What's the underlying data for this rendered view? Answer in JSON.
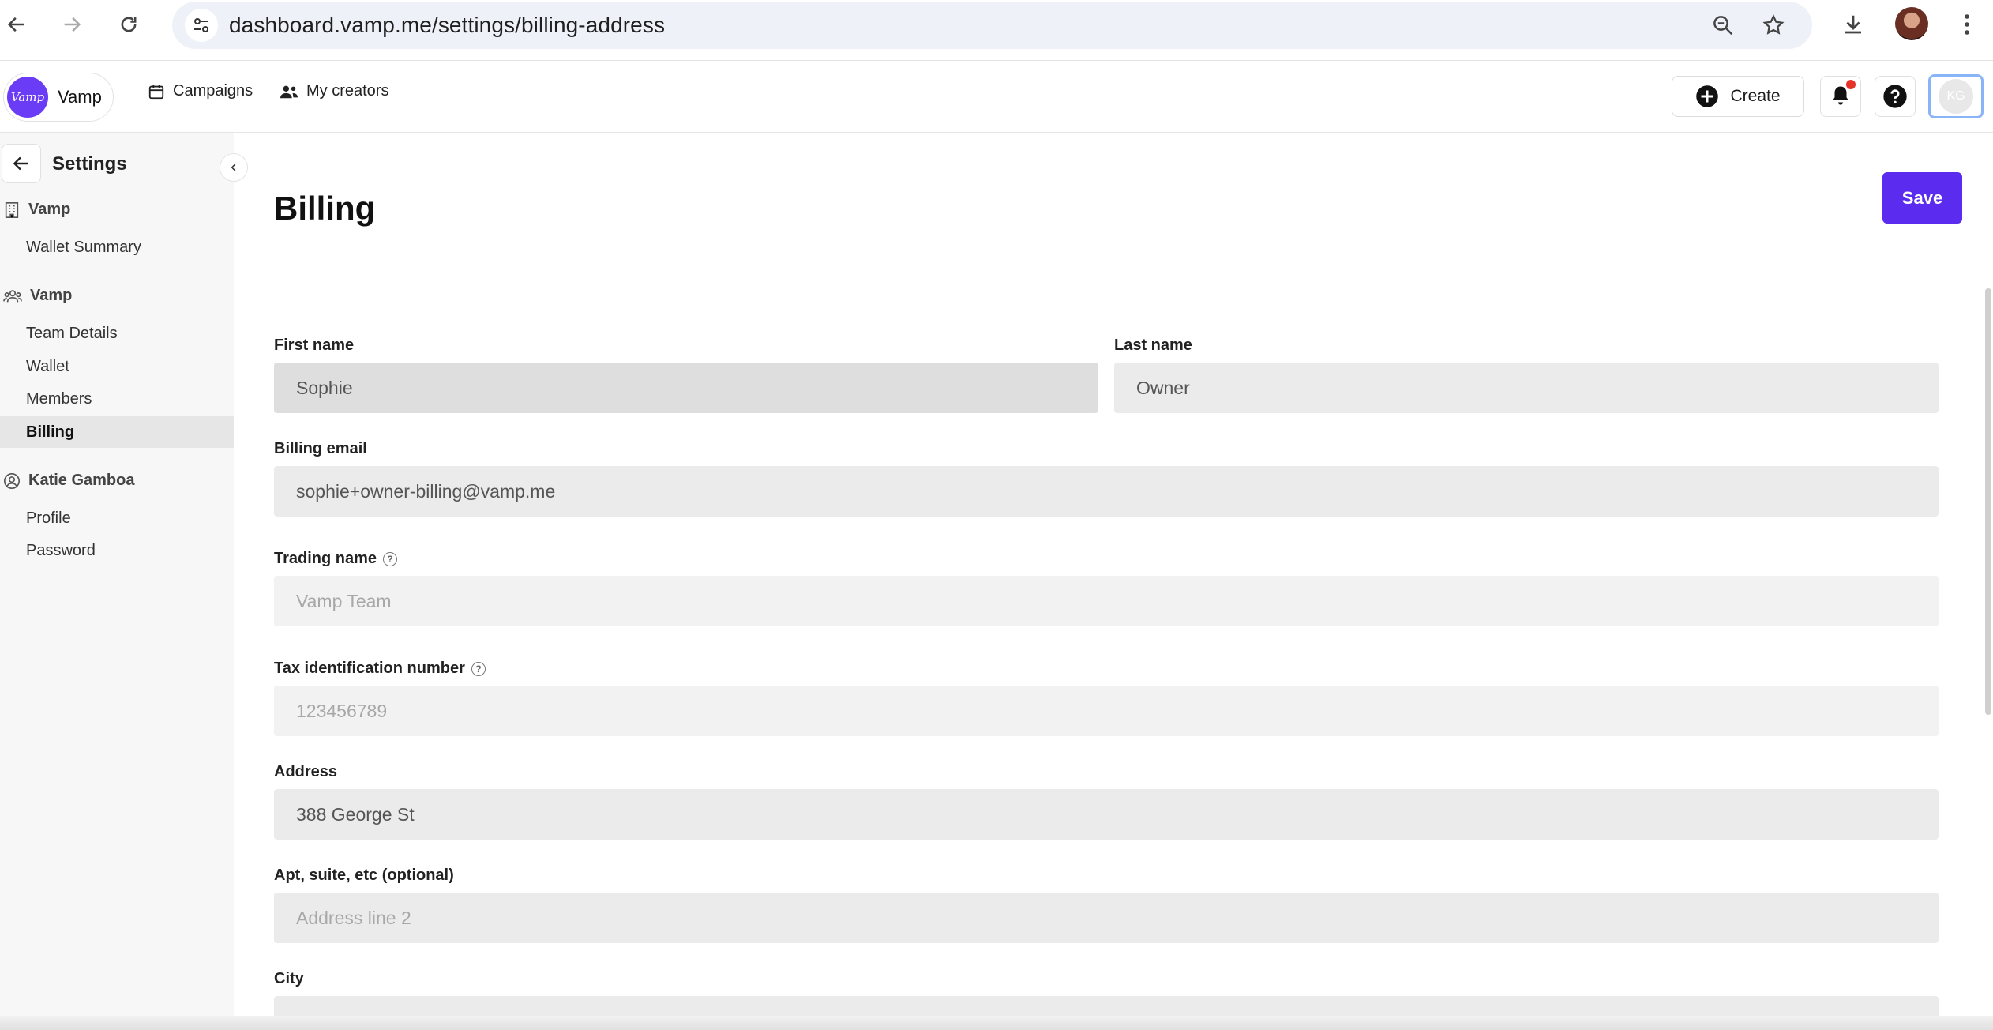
{
  "browser": {
    "url": "dashboard.vamp.me/settings/billing-address"
  },
  "header": {
    "brand_logo_text": "Vamp",
    "brand_name": "Vamp",
    "nav": [
      {
        "label": "Campaigns",
        "icon": "calendar-icon"
      },
      {
        "label": "My creators",
        "icon": "users-icon"
      }
    ],
    "create_label": "Create",
    "avatar_initials": "KG"
  },
  "sidebar": {
    "title": "Settings",
    "groups": [
      {
        "label": "Vamp",
        "icon": "building-icon",
        "items": [
          "Wallet Summary"
        ]
      },
      {
        "label": "Vamp",
        "icon": "team-icon",
        "items": [
          "Team Details",
          "Wallet",
          "Members",
          "Billing"
        ]
      },
      {
        "label": "Katie Gamboa",
        "icon": "user-circle-icon",
        "items": [
          "Profile",
          "Password"
        ]
      }
    ],
    "active_item": "Billing"
  },
  "main": {
    "title": "Billing",
    "save_label": "Save",
    "fields": {
      "first_name": {
        "label": "First name",
        "value": "Sophie"
      },
      "last_name": {
        "label": "Last name",
        "value": "Owner"
      },
      "billing_email": {
        "label": "Billing email",
        "value": "sophie+owner-billing@vamp.me"
      },
      "trading_name": {
        "label": "Trading name",
        "placeholder": "Vamp Team"
      },
      "tax_id": {
        "label": "Tax identification number",
        "placeholder": "123456789"
      },
      "address": {
        "label": "Address",
        "value": "388 George St"
      },
      "apt": {
        "label": "Apt, suite, etc (optional)",
        "placeholder": "Address line 2"
      },
      "city": {
        "label": "City"
      }
    }
  },
  "colors": {
    "accent": "#5b2cf0",
    "notification_dot": "#e5332a"
  }
}
